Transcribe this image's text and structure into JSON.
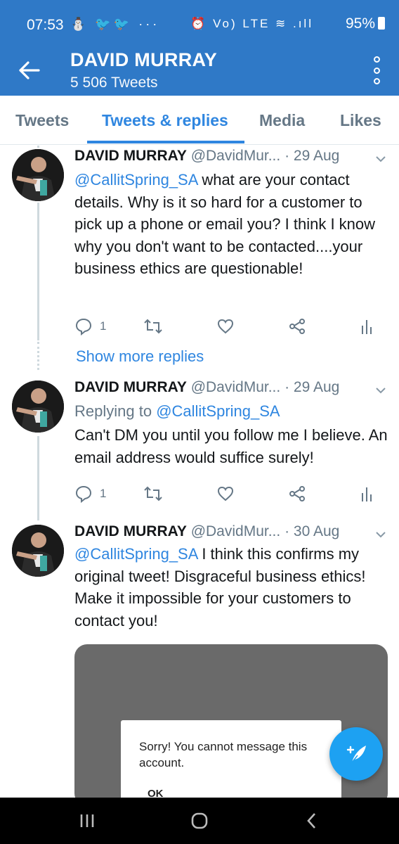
{
  "status_bar": {
    "time": "07:53",
    "left_icons": "⛄ 🐦🐦 ···",
    "right_icons": "⏰ Vo) LTE ≋ .ıll",
    "battery": "95%"
  },
  "header": {
    "title": "DAVID MURRAY",
    "subtitle": "5 506 Tweets",
    "accent_color": "#2f79c7"
  },
  "tabs": [
    {
      "label": "Tweets"
    },
    {
      "label": "Tweets & replies"
    },
    {
      "label": "Media"
    },
    {
      "label": "Likes"
    }
  ],
  "tweets": [
    {
      "display_name": "DAVID MURRAY",
      "handle": "@DavidMur...",
      "date": "· 29 Aug",
      "mention": "@CallitSpring_SA",
      "text": " what are your contact details. Why is it so hard for a customer to pick up a phone or email you? I think I know why you don't want to be contacted....your business ethics are questionable!",
      "reply_count": "1"
    },
    {
      "display_name": "DAVID MURRAY",
      "handle": "@DavidMur...",
      "date": "· 29 Aug",
      "replying_prefix": "Replying to ",
      "replying_to": "@CallitSpring_SA",
      "text": "Can't DM you until you follow me I believe. An email address would suffice surely!",
      "reply_count": "1"
    },
    {
      "display_name": "DAVID MURRAY",
      "handle": "@DavidMur...",
      "date": "· 30 Aug",
      "mention": "@CallitSpring_SA",
      "text": " I think this confirms my original tweet! Disgraceful business ethics! Make it impossible for your customers to contact you!",
      "media": {
        "dialog_message": "Sorry! You cannot message this account.",
        "dialog_button": "OK"
      }
    }
  ],
  "show_more_replies": "Show more replies",
  "fab_icon": "compose-tweet-icon"
}
